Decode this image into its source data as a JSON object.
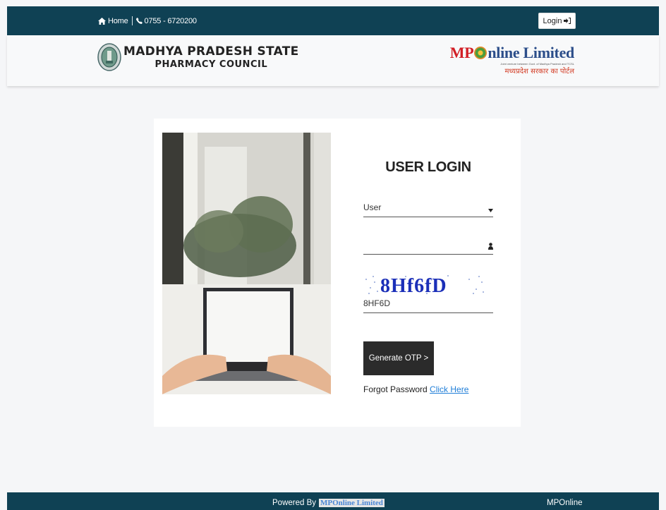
{
  "topbar": {
    "home_label": "Home",
    "phone": "0755 - 6720200",
    "login_label": "Login"
  },
  "header": {
    "council_line1": "MADHYA PRADESH STATE",
    "council_line2": "PHARMACY COUNCIL",
    "brand_mp": "MP",
    "brand_rest": "nline Limited",
    "brand_tagline": "Joint venture between Govt. of Madhya Pradesh and TCSL",
    "brand_hindi": "मध्यप्रदेश सरकार का पोर्टल"
  },
  "login": {
    "title": "USER LOGIN",
    "user_select_value": "User",
    "id_value": "",
    "captcha_image_text": "8Hf6fD",
    "captcha_value": "8HF6D",
    "generate_otp_label": "Generate OTP >",
    "forgot_label": "Forgot Password",
    "click_here_label": "Click Here"
  },
  "footer": {
    "powered_label": "Powered By",
    "powered_brand": "MPOnline Limited",
    "right_text": "MPOnline"
  },
  "colors": {
    "topbar_bg": "#0f4154",
    "button_bg": "#2b2b2b",
    "link": "#1f7ed8"
  }
}
